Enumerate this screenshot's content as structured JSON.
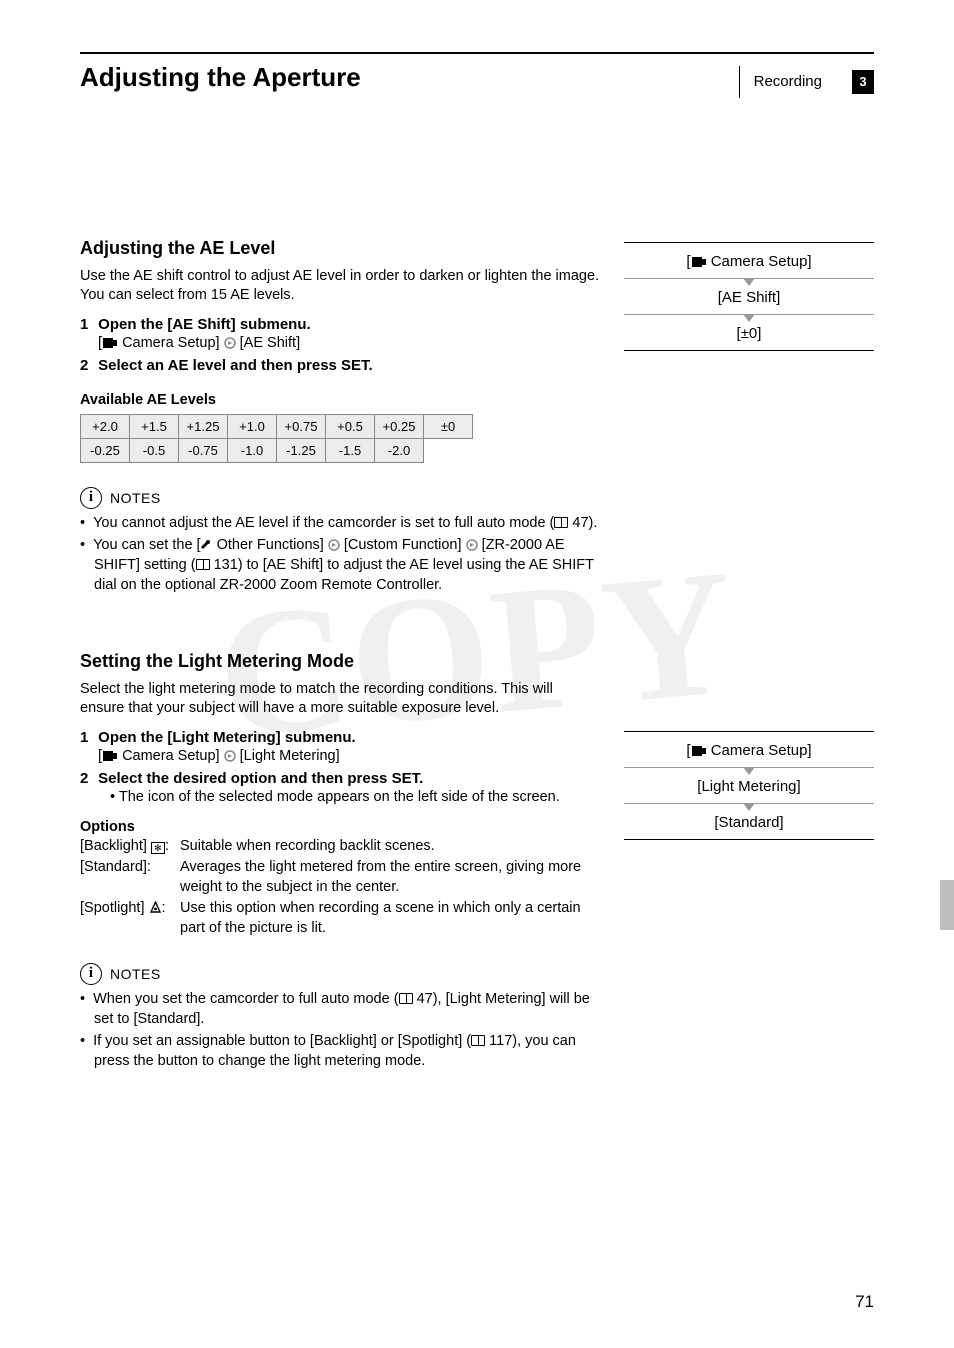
{
  "header": {
    "title": "Adjusting the Aperture",
    "section": "Recording",
    "chapter": "3"
  },
  "ae": {
    "heading": "Adjusting the AE Level",
    "intro": "Use the AE shift control to adjust AE level in order to darken or lighten the image. You can select from 15 AE levels.",
    "step1": "Open the [AE Shift] submenu.",
    "step1_path_a": "Camera Setup]",
    "step1_path_b": "[AE Shift]",
    "step2": "Select an AE level and then press SET.",
    "available": "Available AE Levels",
    "row1": [
      "+2.0",
      "+1.5",
      "+1.25",
      "+1.0",
      "+0.75",
      "+0.5",
      "+0.25",
      "±0"
    ],
    "row2": [
      "-0.25",
      "-0.5",
      "-0.75",
      "-1.0",
      "-1.25",
      "-1.5",
      "-2.0"
    ],
    "notes_label": "NOTES",
    "note1": "You cannot adjust the AE level if the camcorder is set to full auto mode (",
    "note1_ref": "47).",
    "note2a": "You can set the [",
    "note2b": " Other Functions]",
    "note2c": "[Custom Function]",
    "note2d": "[ZR-2000 AE SHIFT] setting (",
    "note2e": "131) to [AE Shift] to adjust the AE level using the AE SHIFT dial on the optional ZR-2000 Zoom Remote Controller.",
    "path": {
      "p1": "Camera Setup]",
      "p2": "[AE Shift]",
      "p3": "[±0]"
    }
  },
  "lm": {
    "heading": "Setting the Light Metering Mode",
    "intro": "Select the light metering mode to match the recording conditions. This will ensure that your subject will have a more suitable exposure level.",
    "step1": "Open the [Light Metering] submenu.",
    "step1_path_a": "Camera Setup]",
    "step1_path_b": "[Light Metering]",
    "step2": "Select the desired option and then press SET.",
    "step2_sub": "The icon of the selected mode appears on the left side of the screen.",
    "options_title": "Options",
    "opt1_label": "[Backlight]",
    "opt1_desc": "Suitable when recording backlit scenes.",
    "opt2_label": "[Standard]:",
    "opt2_desc": "Averages the light metered from the entire screen, giving more weight to the subject in the center.",
    "opt3_label": "[Spotlight]",
    "opt3_desc": "Use this option when recording a scene in which only a certain part of the picture is lit.",
    "notes_label": "NOTES",
    "note1a": "When you set the camcorder to full auto mode (",
    "note1b": "47), [Light Metering] will be set to [Standard].",
    "note2a": "If you set an assignable button to [Backlight] or [Spotlight] (",
    "note2b": "117), you can press the button to change the light metering mode.",
    "path": {
      "p1": "Camera Setup]",
      "p2": "[Light Metering]",
      "p3": "[Standard]"
    }
  },
  "pagenum": "71"
}
